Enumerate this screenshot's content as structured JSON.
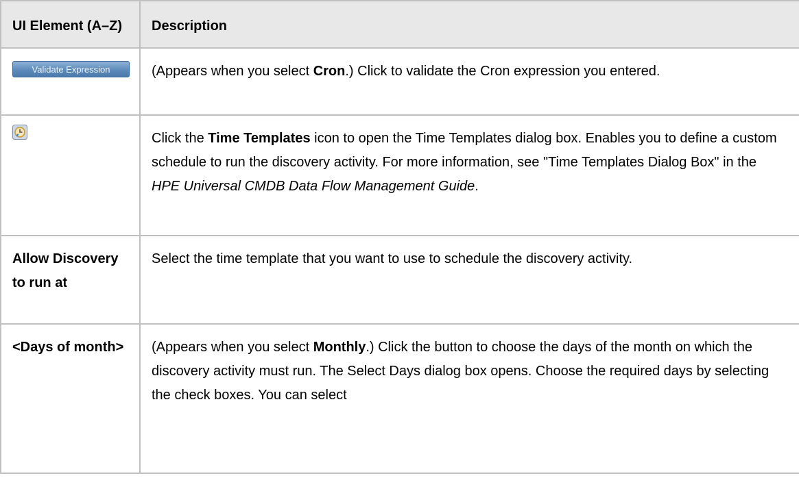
{
  "header": {
    "col1": "UI Element (A–Z)",
    "col2": "Description"
  },
  "rows": [
    {
      "element": {
        "button_label": "Validate Expression"
      },
      "description": {
        "t1": "(Appears when you select ",
        "b1": "Cron",
        "t2": ".) Click to validate the Cron expression you entered."
      }
    },
    {
      "element": {
        "icon": "time-templates-icon"
      },
      "description": {
        "t1": "Click the ",
        "b1": "Time Templates",
        "t2": " icon to open the Time Templates dialog box. Enables you to define a custom schedule to run the discovery activity. For more information, see \"Time Templates Dialog Box\" in the ",
        "i1": "HPE Universal CMDB Data Flow Management Guide",
        "t3": "."
      }
    },
    {
      "element": {
        "label": "Allow Discovery to run at"
      },
      "description": {
        "t1": "Select the time template that you want to use to schedule the discovery activity."
      }
    },
    {
      "element": {
        "label": "<Days of month>"
      },
      "description": {
        "t1": "(Appears when you select ",
        "b1": "Monthly",
        "t2": ".) Click the button to choose the days of the month on which the discovery activity must run. The Select Days dialog box opens. Choose the required days by selecting the check boxes. You can select"
      }
    }
  ]
}
